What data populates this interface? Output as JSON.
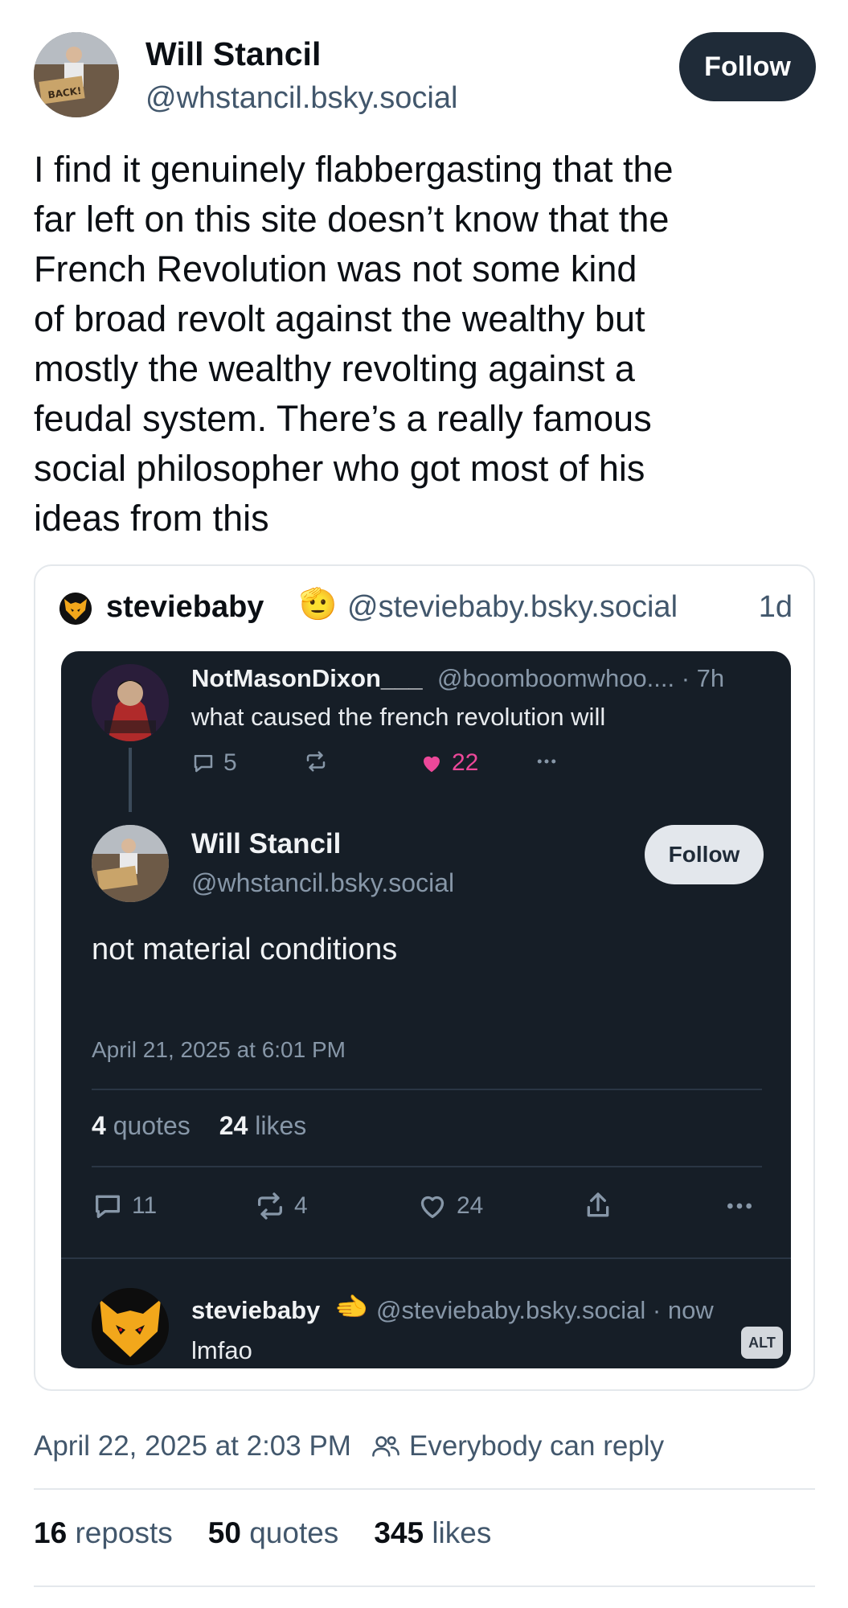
{
  "post": {
    "author_name": "Will Stancil",
    "author_handle": "@whstancil.bsky.social",
    "follow_label": "Follow",
    "avatar_sign_text": "BACK!",
    "text": "I find it genuinely flabbergasting that the\nfar left on this site doesn’t know that the\nFrench Revolution was not some kind\nof broad revolt against the wealthy but\nmostly the wealthy revolting against a\nfeudal system. There’s a really famous\nsocial philosopher who got most of his\nideas from this",
    "timestamp": "April 22, 2025 at 2:03 PM",
    "reply_setting": "Everybody can reply",
    "reposts_count": "16",
    "reposts_label": "reposts",
    "quotes_count": "50",
    "quotes_label": "quotes",
    "likes_count": "345",
    "likes_label": "likes"
  },
  "quote": {
    "author_name": "steviebaby",
    "author_emoji": "🫡",
    "author_handle": "@steviebaby.bsky.social",
    "time": "1d",
    "embed": {
      "parent": {
        "name": "NotMasonDixon___",
        "handle_time": "@boomboomwhoo.... · 7h",
        "text": "what caused the french revolution will",
        "replies": "5",
        "likes": "22"
      },
      "main": {
        "name": "Will Stancil",
        "handle": "@whstancil.bsky.social",
        "follow_label": "Follow",
        "text": "not material conditions",
        "date": "April 21, 2025 at 6:01 PM",
        "quotes_count": "4",
        "quotes_label": "quotes",
        "likes_count": "24",
        "likes_label": "likes",
        "replies": "11",
        "reposts": "4",
        "likes": "24"
      },
      "reply": {
        "name": "steviebaby",
        "emoji": "🫲",
        "handle_time": "@steviebaby.bsky.social · now",
        "text": "lmfao",
        "alt_label": "ALT"
      }
    }
  },
  "colors": {
    "accent_dark": "#1f2b38",
    "muted_text": "#42576c",
    "embed_bg": "#161e27",
    "like_pink": "#ec4899"
  },
  "icons": [
    "people-icon",
    "reply-icon",
    "repost-icon",
    "heart-icon",
    "share-icon",
    "more-icon",
    "wolf-logo-icon"
  ]
}
